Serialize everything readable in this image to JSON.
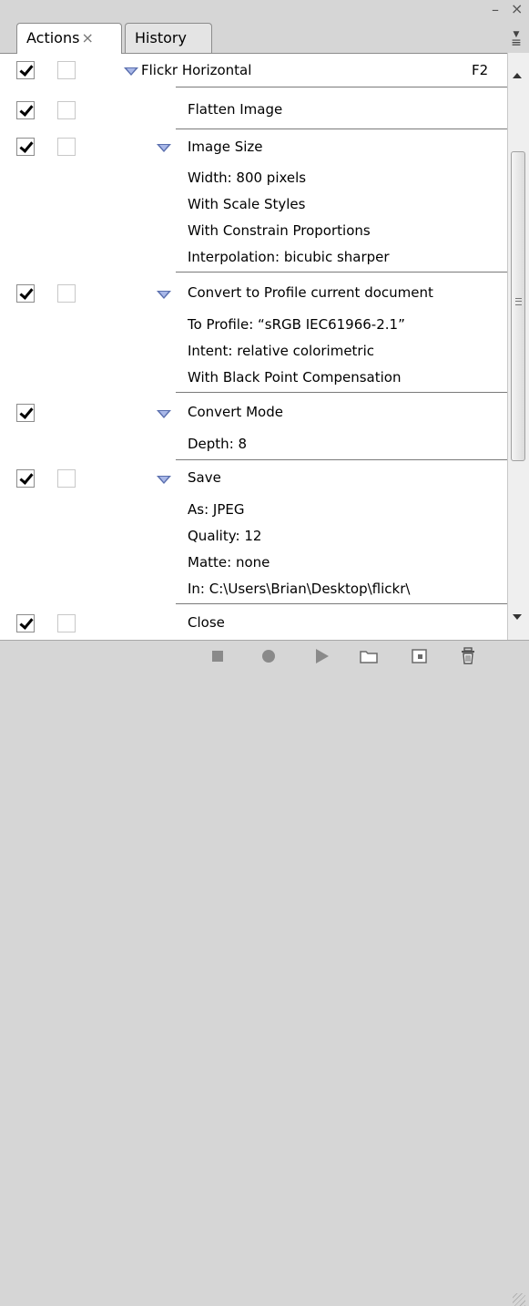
{
  "window": {
    "minimize_glyph": "–",
    "close_glyph": "×",
    "menu_glyph": "≡"
  },
  "tabs": [
    {
      "label": "Actions",
      "close": "×",
      "active": true
    },
    {
      "label": "History",
      "active": false
    }
  ],
  "action_set": {
    "name": "Flickr Horizontal",
    "shortcut": "F2"
  },
  "steps": [
    {
      "label": "Flatten Image"
    },
    {
      "label": "Image Size",
      "details": [
        "Width: 800 pixels",
        "With Scale Styles",
        "With Constrain Proportions",
        "Interpolation: bicubic sharper"
      ]
    },
    {
      "label": "Convert to Profile current document",
      "details": [
        "To Profile:  “sRGB IEC61966-2.1”",
        "Intent: relative colorimetric",
        "With Black Point Compensation"
      ]
    },
    {
      "label": "Convert Mode",
      "details": [
        "Depth: 8"
      ]
    },
    {
      "label": "Save",
      "details": [
        "As: JPEG",
        "Quality: 12",
        "Matte: none",
        "In: C:\\Users\\Brian\\Desktop\\flickr\\"
      ]
    },
    {
      "label": "Close"
    }
  ],
  "toolbar": {
    "stop": "stop-icon",
    "record": "record-icon",
    "play": "play-icon",
    "new_set": "folder-icon",
    "new_action": "new-action-icon",
    "delete": "trash-icon"
  },
  "colors": {
    "panel_bg": "#d6d6d6",
    "triangle": "#5a6fae"
  }
}
